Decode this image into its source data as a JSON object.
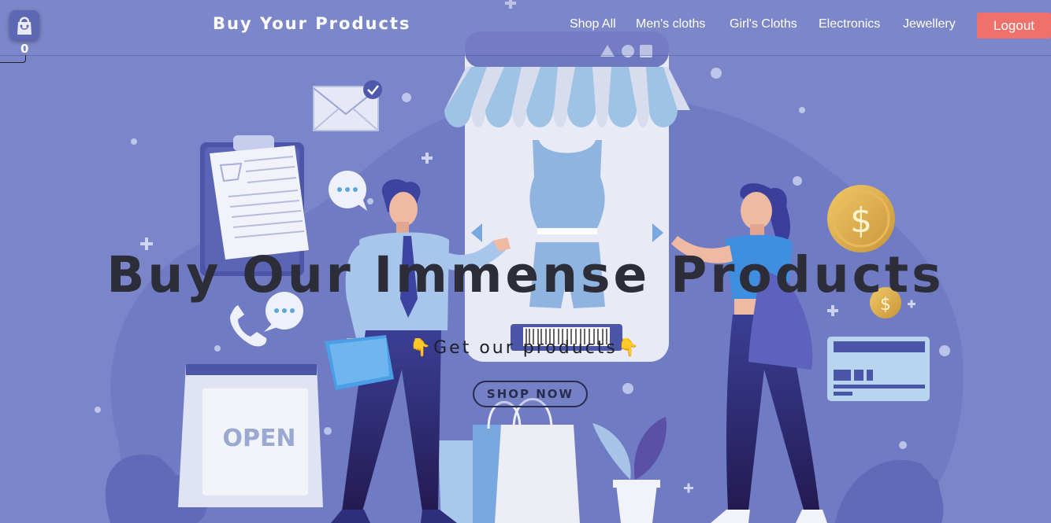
{
  "header": {
    "brand": "Buy Your Products",
    "cart_count": "0",
    "nav": [
      {
        "label": "Shop All"
      },
      {
        "label": "Men's cloths"
      },
      {
        "label": "Girl's Cloths"
      },
      {
        "label": "Electronics"
      },
      {
        "label": "Jewellery"
      }
    ],
    "logout_label": "Logout"
  },
  "hero": {
    "title": "Buy Our Immense Products",
    "subtitle": "👇Get our products👇",
    "cta_label": "SHOP NOW",
    "sign_text": "OPEN",
    "coin_symbol": "$"
  },
  "colors": {
    "background": "#7a86c9",
    "accent": "#f0706c",
    "title": "#2c2d38"
  }
}
